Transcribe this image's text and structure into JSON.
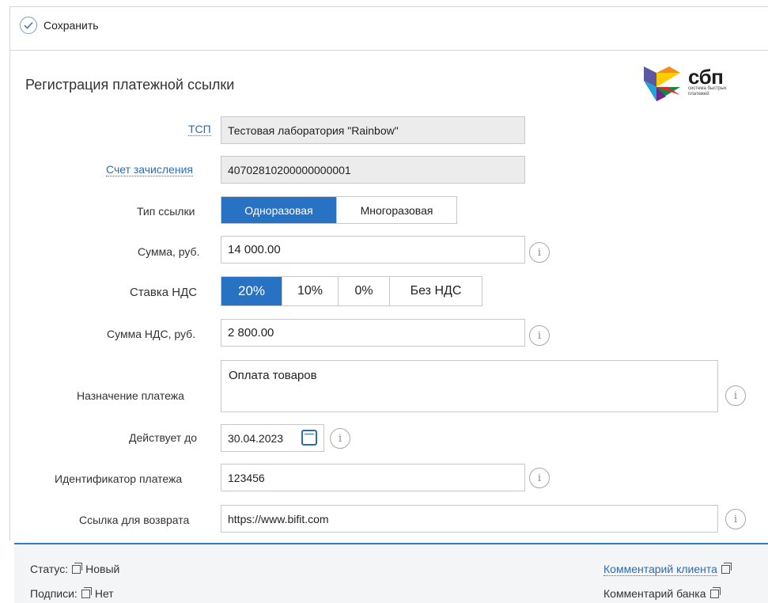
{
  "toolbar": {
    "save_label": "Сохранить"
  },
  "page": {
    "title": "Регистрация платежной ссылки"
  },
  "logo": {
    "word": "сбп",
    "subtitle": "система быстрых платежей"
  },
  "form": {
    "tsp": {
      "label": "ТСП",
      "value": "Тестовая лаборатория \"Rainbow\""
    },
    "account": {
      "label": "Счет зачисления",
      "value": "40702810200000000001"
    },
    "link_type": {
      "label": "Тип ссылки",
      "options": [
        "Одноразовая",
        "Многоразовая"
      ],
      "selected": "Одноразовая"
    },
    "amount": {
      "label": "Сумма, руб.",
      "value": "14 000.00",
      "info": "i"
    },
    "vat_rate": {
      "label": "Ставка НДС",
      "options": [
        "20%",
        "10%",
        "0%",
        "Без НДС"
      ],
      "selected": "20%"
    },
    "vat_amount": {
      "label": "Сумма НДС, руб.",
      "value": "2 800.00",
      "info": "i"
    },
    "purpose": {
      "label": "Назначение платежа",
      "value": "Оплата товаров",
      "info": "i"
    },
    "valid_until": {
      "label": "Действует до",
      "value": "30.04.2023",
      "info": "i"
    },
    "payment_id": {
      "label": "Идентификатор платежа",
      "value": "123456",
      "info": "i"
    },
    "return_url": {
      "label": "Ссылка для возврата",
      "value": "https://www.bifit.com",
      "info": "i"
    }
  },
  "footer": {
    "status_label": "Статус:",
    "status_value": "Новый",
    "signatures_label": "Подписи:",
    "signatures_value": "Нет",
    "client_comment": "Комментарий клиента",
    "bank_comment": "Комментарий банка"
  },
  "colors": {
    "accent": "#2872c4",
    "link": "#2c6cb0",
    "readonly_bg": "#ececec",
    "footer_line": "#2b7cd3"
  }
}
